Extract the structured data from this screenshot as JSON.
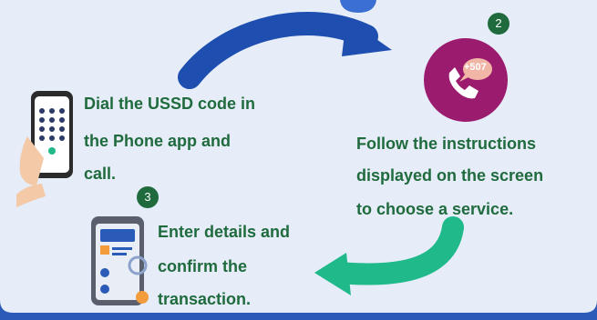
{
  "steps": [
    {
      "number": "",
      "lines": [
        "Dial the USSD code in",
        "the Phone app and",
        "call."
      ]
    },
    {
      "number": "2",
      "lines": [
        "Follow the instructions",
        "displayed on the screen",
        "to choose a service."
      ],
      "badge_text": "+507"
    },
    {
      "number": "3",
      "lines": [
        "Enter details and",
        "confirm the",
        "transaction."
      ]
    }
  ],
  "colors": {
    "background": "#e6edf8",
    "border": "#2b5bb8",
    "text": "#1f6b3e",
    "arrow_blue": "#1e4fb0",
    "arrow_green": "#1fb98a",
    "phone_circle": "#9b1b6e"
  },
  "icons": [
    "hand-holding-phone-icon",
    "phone-call-icon",
    "transaction-phone-icon"
  ]
}
